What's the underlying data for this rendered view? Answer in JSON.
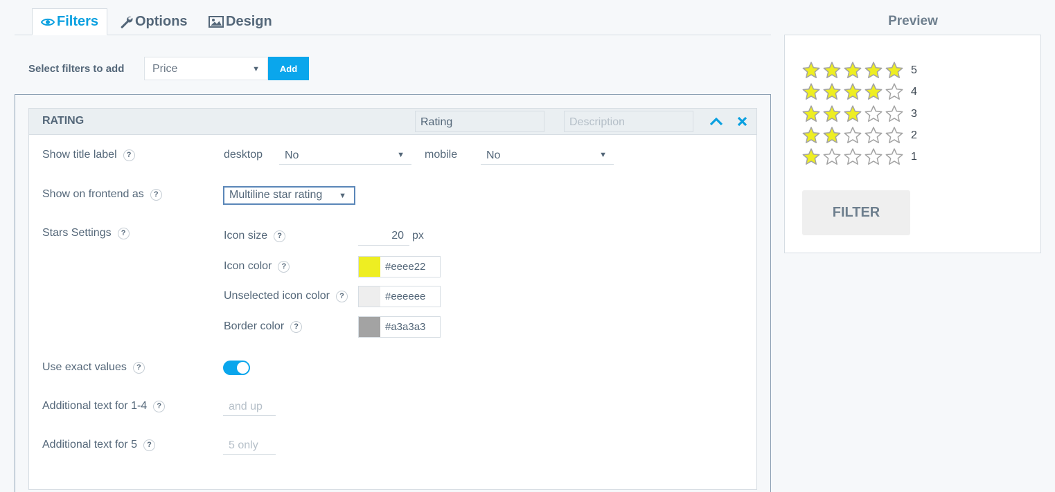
{
  "tabs": [
    {
      "label": "Filters",
      "icon": "eye-icon"
    },
    {
      "label": "Options",
      "icon": "wrench-icon"
    },
    {
      "label": "Design",
      "icon": "image-icon"
    }
  ],
  "select_filters": {
    "label": "Select filters to add",
    "value": "Price",
    "add_label": "Add"
  },
  "card": {
    "title": "RATING",
    "title_value": "Rating",
    "description_placeholder": "Description"
  },
  "show_title_label": {
    "label": "Show title label",
    "desktop_label": "desktop",
    "desktop_value": "No",
    "mobile_label": "mobile",
    "mobile_value": "No"
  },
  "show_on_frontend": {
    "label": "Show on frontend as",
    "value": "Multiline star rating"
  },
  "stars_settings": {
    "label": "Stars Settings",
    "icon_size_label": "Icon size",
    "icon_size_value": "20",
    "icon_size_unit": "px",
    "icon_color_label": "Icon color",
    "icon_color": "#eeee22",
    "unselected_label": "Unselected icon color",
    "unselected_color": "#eeeeee",
    "border_label": "Border color",
    "border_color": "#a3a3a3"
  },
  "use_exact_values": {
    "label": "Use exact values",
    "on": true
  },
  "additional_1_4": {
    "label": "Additional text for 1-4",
    "placeholder": "and up"
  },
  "additional_5": {
    "label": "Additional text for 5",
    "placeholder": "5 only"
  },
  "preview": {
    "title": "Preview",
    "ratings": [
      5,
      4,
      3,
      2,
      1
    ],
    "ratings_text": [
      "5",
      "4",
      "3",
      "2",
      "1"
    ],
    "filter_label": "FILTER"
  },
  "help_mark": "?"
}
